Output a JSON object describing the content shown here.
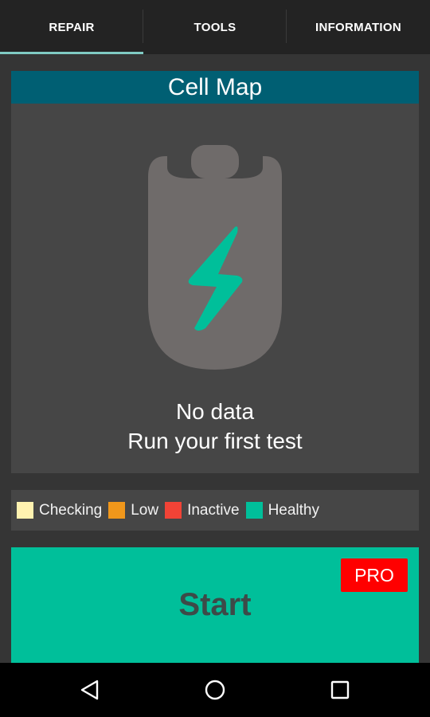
{
  "tabs": [
    {
      "label": "REPAIR",
      "active": true
    },
    {
      "label": "TOOLS",
      "active": false
    },
    {
      "label": "INFORMATION",
      "active": false
    }
  ],
  "cellmap": {
    "title": "Cell Map",
    "status_line1": "No data",
    "status_line2": "Run your first test",
    "icon": "battery-charging-icon"
  },
  "legend": [
    {
      "label": "Checking",
      "color": "#fff2b0"
    },
    {
      "label": "Low",
      "color": "#f0971b"
    },
    {
      "label": "Inactive",
      "color": "#f14336"
    },
    {
      "label": "Healthy",
      "color": "#00bf9a"
    }
  ],
  "start_button": {
    "label": "Start",
    "badge": "PRO"
  },
  "navbar": {
    "icons": [
      "back-icon",
      "home-icon",
      "recents-icon"
    ]
  },
  "colors": {
    "accent": "#00bf9a",
    "header": "#005f73",
    "tab_indicator": "#80cbc4",
    "pro_badge": "#ff0000"
  }
}
